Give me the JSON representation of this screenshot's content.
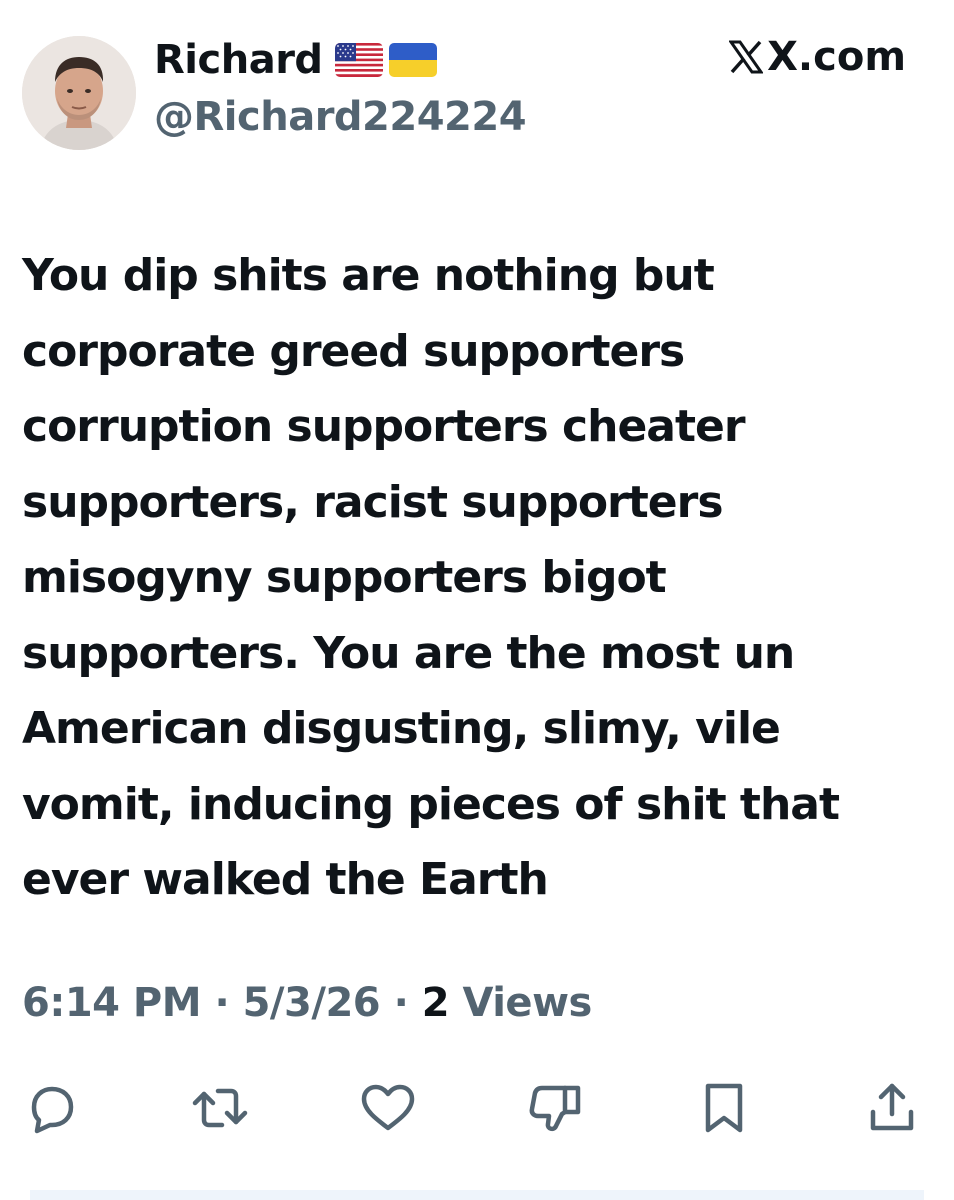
{
  "tweet": {
    "author": {
      "display_name": "Richard",
      "handle": "@Richard224224",
      "flags": [
        "us-flag-icon",
        "ukraine-flag-icon"
      ]
    },
    "source": "X.com",
    "text": "You dip shits are nothing but corporate greed supporters corruption supporters cheater supporters, racist supporters misogyny supporters bigot supporters. You are the most un American disgusting, slimy, vile vomit, inducing pieces of shit that ever walked the Earth",
    "meta": {
      "time": "6:14 PM",
      "separator": " · ",
      "date": "5/3/26",
      "views_count": "2",
      "views_label": "Views"
    },
    "actions": [
      "reply-icon",
      "retweet-icon",
      "like-icon",
      "dislike-icon",
      "bookmark-icon",
      "share-icon"
    ]
  },
  "colors": {
    "text_primary": "#0f1419",
    "text_secondary": "#536471",
    "background": "#ffffff"
  }
}
